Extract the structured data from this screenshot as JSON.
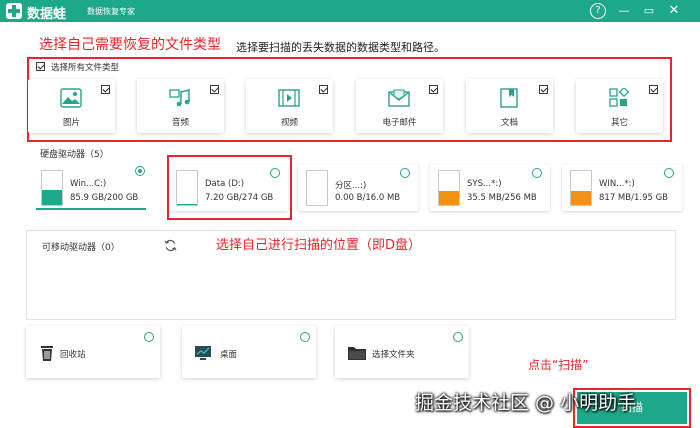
{
  "app": {
    "name": "数据蛙",
    "subtitle": "数据恢复专家"
  },
  "window_controls": {
    "help": "?",
    "minimize": "—",
    "maximize": "▭",
    "close": "✕"
  },
  "annotations": {
    "select_types": "选择自己需要恢复的文件类型",
    "select_location": "选择自己进行扫描的位置（即D盘）",
    "click_scan": "点击“扫描”"
  },
  "instruction": "选择要扫描的丢失数据的数据类型和路径。",
  "select_all": {
    "label": "选择所有文件类型",
    "checked": true
  },
  "file_types": [
    {
      "label": "图片",
      "icon": "image-icon",
      "checked": true
    },
    {
      "label": "音频",
      "icon": "music-icon",
      "checked": true
    },
    {
      "label": "视频",
      "icon": "video-icon",
      "checked": true
    },
    {
      "label": "电子邮件",
      "icon": "email-icon",
      "checked": true
    },
    {
      "label": "文档",
      "icon": "document-icon",
      "checked": true
    },
    {
      "label": "其它",
      "icon": "other-icon",
      "checked": true
    }
  ],
  "hard_drives": {
    "title": "硬盘驱动器（5）",
    "drives": [
      {
        "name": "Win...C:)",
        "size": "85.9 GB/200 GB",
        "fill_ratio": 0.43,
        "fill_color": "#1ea88a",
        "selected": true
      },
      {
        "name": "Data (D:)",
        "size": "7.20 GB/274 GB",
        "fill_ratio": 0.03,
        "fill_color": "#1ea88a",
        "selected": false
      },
      {
        "name": "分区...:)",
        "size": "0.00  B/16.0 MB",
        "fill_ratio": 0.0,
        "fill_color": "#1ea88a",
        "selected": false
      },
      {
        "name": "SYS...*:)",
        "size": "35.5 MB/256 MB",
        "fill_ratio": 0.4,
        "fill_color": "#f39214",
        "selected": false
      },
      {
        "name": "WIN...*:)",
        "size": "817 MB/1.95 GB",
        "fill_ratio": 0.42,
        "fill_color": "#f39214",
        "selected": false
      }
    ]
  },
  "removable": {
    "title": "可移动驱动器（0）",
    "refresh_icon": "refresh-icon"
  },
  "locations": [
    {
      "label": "回收站",
      "icon": "recycle-bin-icon"
    },
    {
      "label": "桌面",
      "icon": "desktop-icon"
    },
    {
      "label": "选择文件夹",
      "icon": "folder-icon"
    }
  ],
  "scan_button": {
    "label": "扫描"
  },
  "watermark": "掘金技术社区 @ 小明助手",
  "colors": {
    "brand": "#1ea88a",
    "annotation": "#e5262d",
    "warning": "#f39214"
  }
}
